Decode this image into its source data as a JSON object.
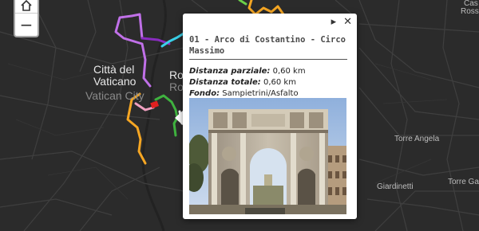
{
  "map": {
    "labels": {
      "citta_line1": "Città del",
      "citta_line2": "Vaticano",
      "vatican_city": "Vatican City",
      "roma_partial_1": "Ro",
      "roma_partial_2": "Ro",
      "torre_angela": "Torre Angela",
      "giardinetti": "Giardinetti",
      "torre_gaia_partial": "Torre Gai",
      "cas_partial": "Cas",
      "ross_partial": "Ross"
    },
    "colors": {
      "background": "#2b2b2b",
      "roads": "#3f3f3f",
      "route_magenta": "#c070e8",
      "route_purple": "#8a2cc0",
      "route_cyan": "#3ad0e8",
      "route_orange": "#f5a623",
      "route_green": "#3fb23f",
      "route_red": "#e02020",
      "route_pink": "#f0a0c0"
    }
  },
  "zoom": {
    "home_icon": "home-icon",
    "zoom_out": "−"
  },
  "popup": {
    "title": "01 - Arco di Costantino - Circo Massimo",
    "controls": {
      "next": "▸",
      "close": "✕"
    },
    "distanza_parziale_label": "Distanza parziale:",
    "distanza_parziale_value": "0,60 km",
    "distanza_totale_label": "Distanza totale:",
    "distanza_totale_value": "0,60 km",
    "fondo_label": "Fondo:",
    "fondo_value": "Sampietrini/Asfalto",
    "photo_subject": "arch-of-constantine-photo"
  }
}
